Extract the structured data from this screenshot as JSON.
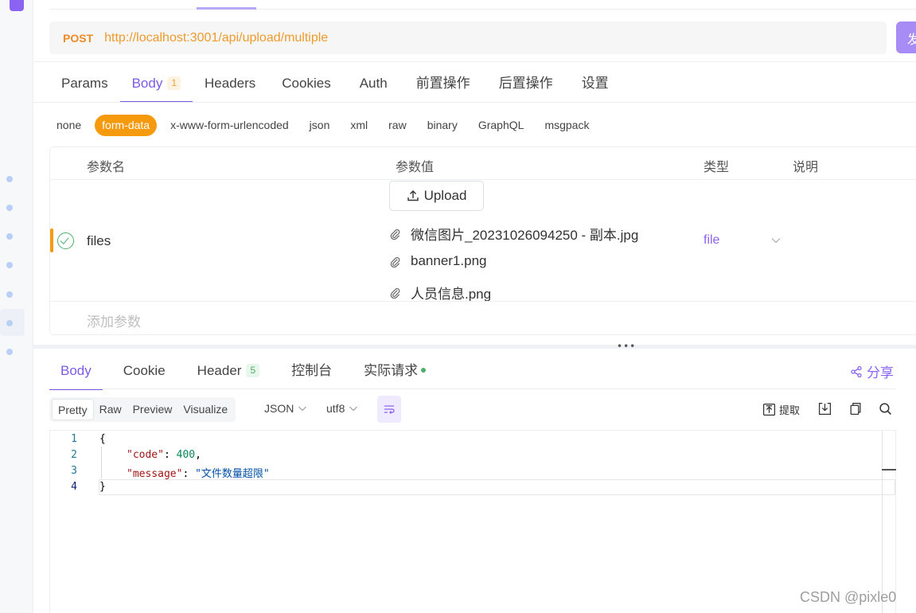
{
  "request": {
    "method": "POST",
    "url": "http://localhost:3001/api/upload/multiple",
    "send_label": "发"
  },
  "request_tabs": [
    {
      "label": "Params"
    },
    {
      "label": "Body",
      "badge": "1"
    },
    {
      "label": "Headers"
    },
    {
      "label": "Cookies"
    },
    {
      "label": "Auth"
    },
    {
      "label": "前置操作"
    },
    {
      "label": "后置操作"
    },
    {
      "label": "设置"
    }
  ],
  "body_types": [
    "none",
    "form-data",
    "x-www-form-urlencoded",
    "json",
    "xml",
    "raw",
    "binary",
    "GraphQL",
    "msgpack"
  ],
  "active_body_type": "form-data",
  "params_table": {
    "headers": {
      "name": "参数名",
      "value": "参数值",
      "type": "类型",
      "desc": "说明"
    },
    "rows": [
      {
        "name": "files",
        "upload_label": "Upload",
        "files": [
          "微信图片_20231026094250 - 副本.jpg",
          "banner1.png",
          "人员信息.png"
        ],
        "type": "file"
      }
    ],
    "add_placeholder": "添加参数"
  },
  "splitter_grip": "•••",
  "response_tabs": [
    {
      "label": "Body"
    },
    {
      "label": "Cookie"
    },
    {
      "label": "Header",
      "badge": "5"
    },
    {
      "label": "控制台"
    },
    {
      "label": "实际请求"
    }
  ],
  "share_label": "分享",
  "view_modes": [
    "Pretty",
    "Raw",
    "Preview",
    "Visualize"
  ],
  "format_select": "JSON",
  "encoding_select": "utf8",
  "extract_label": "提取",
  "code": {
    "line_numbers": [
      "1",
      "2",
      "3",
      "4"
    ],
    "open_brace": "{",
    "code_key": "\"code\"",
    "code_value": "400",
    "message_key": "\"message\"",
    "message_value": "\"文件数量超限\"",
    "close_brace": "}"
  },
  "watermark": "CSDN @pixle0",
  "colors": {
    "accent": "#7b5be6",
    "method": "#ee8a27",
    "active_pill": "#f59a0c",
    "success": "#4caf6a"
  },
  "icons": [
    "upload-icon",
    "paperclip-icon",
    "chevron-down-icon",
    "share-icon",
    "wrap-lines-icon",
    "extract-icon",
    "download-icon",
    "copy-icon",
    "search-icon",
    "check-circle-icon"
  ]
}
